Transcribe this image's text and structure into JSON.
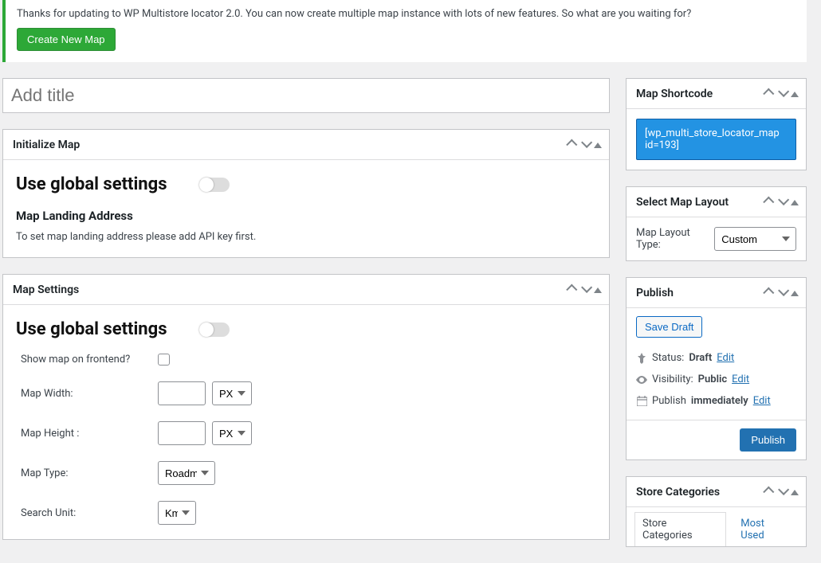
{
  "notice": {
    "text": "Thanks for updating to WP Multistore locator 2.0. You can now create multiple map instance with lots of new features. So what are you waiting for?",
    "button": "Create New Map"
  },
  "title": {
    "placeholder": "Add title",
    "value": ""
  },
  "sections": {
    "initialize": {
      "title": "Initialize Map",
      "global_label": "Use global settings",
      "landing_heading": "Map Landing Address",
      "landing_help": "To set map landing address please add API key first."
    },
    "map_settings": {
      "title": "Map Settings",
      "global_label": "Use global settings",
      "rows": {
        "show_frontend": "Show map on frontend?",
        "map_width": "Map Width:",
        "map_height": "Map Height :",
        "map_type": "Map Type:",
        "search_unit": "Search Unit:"
      },
      "map_width_value": "",
      "map_width_unit": "PX",
      "map_height_value": "",
      "map_height_unit": "PX",
      "map_type_value": "Roadmap",
      "search_unit_value": "Km"
    }
  },
  "sidebar": {
    "shortcode": {
      "title": "Map Shortcode",
      "value": "[wp_multi_store_locator_map id=193]"
    },
    "layout": {
      "title": "Select Map Layout",
      "label": "Map Layout Type:",
      "value": "Custom"
    },
    "publish": {
      "title": "Publish",
      "save_draft": "Save Draft",
      "status_label": "Status:",
      "status_value": "Draft",
      "status_edit": "Edit",
      "visibility_label": "Visibility:",
      "visibility_value": "Public",
      "visibility_edit": "Edit",
      "schedule_label": "Publish",
      "schedule_value": "immediately",
      "schedule_edit": "Edit",
      "publish_button": "Publish"
    },
    "categories": {
      "title": "Store Categories",
      "tab_all": "Store Categories",
      "tab_most": "Most Used"
    }
  }
}
